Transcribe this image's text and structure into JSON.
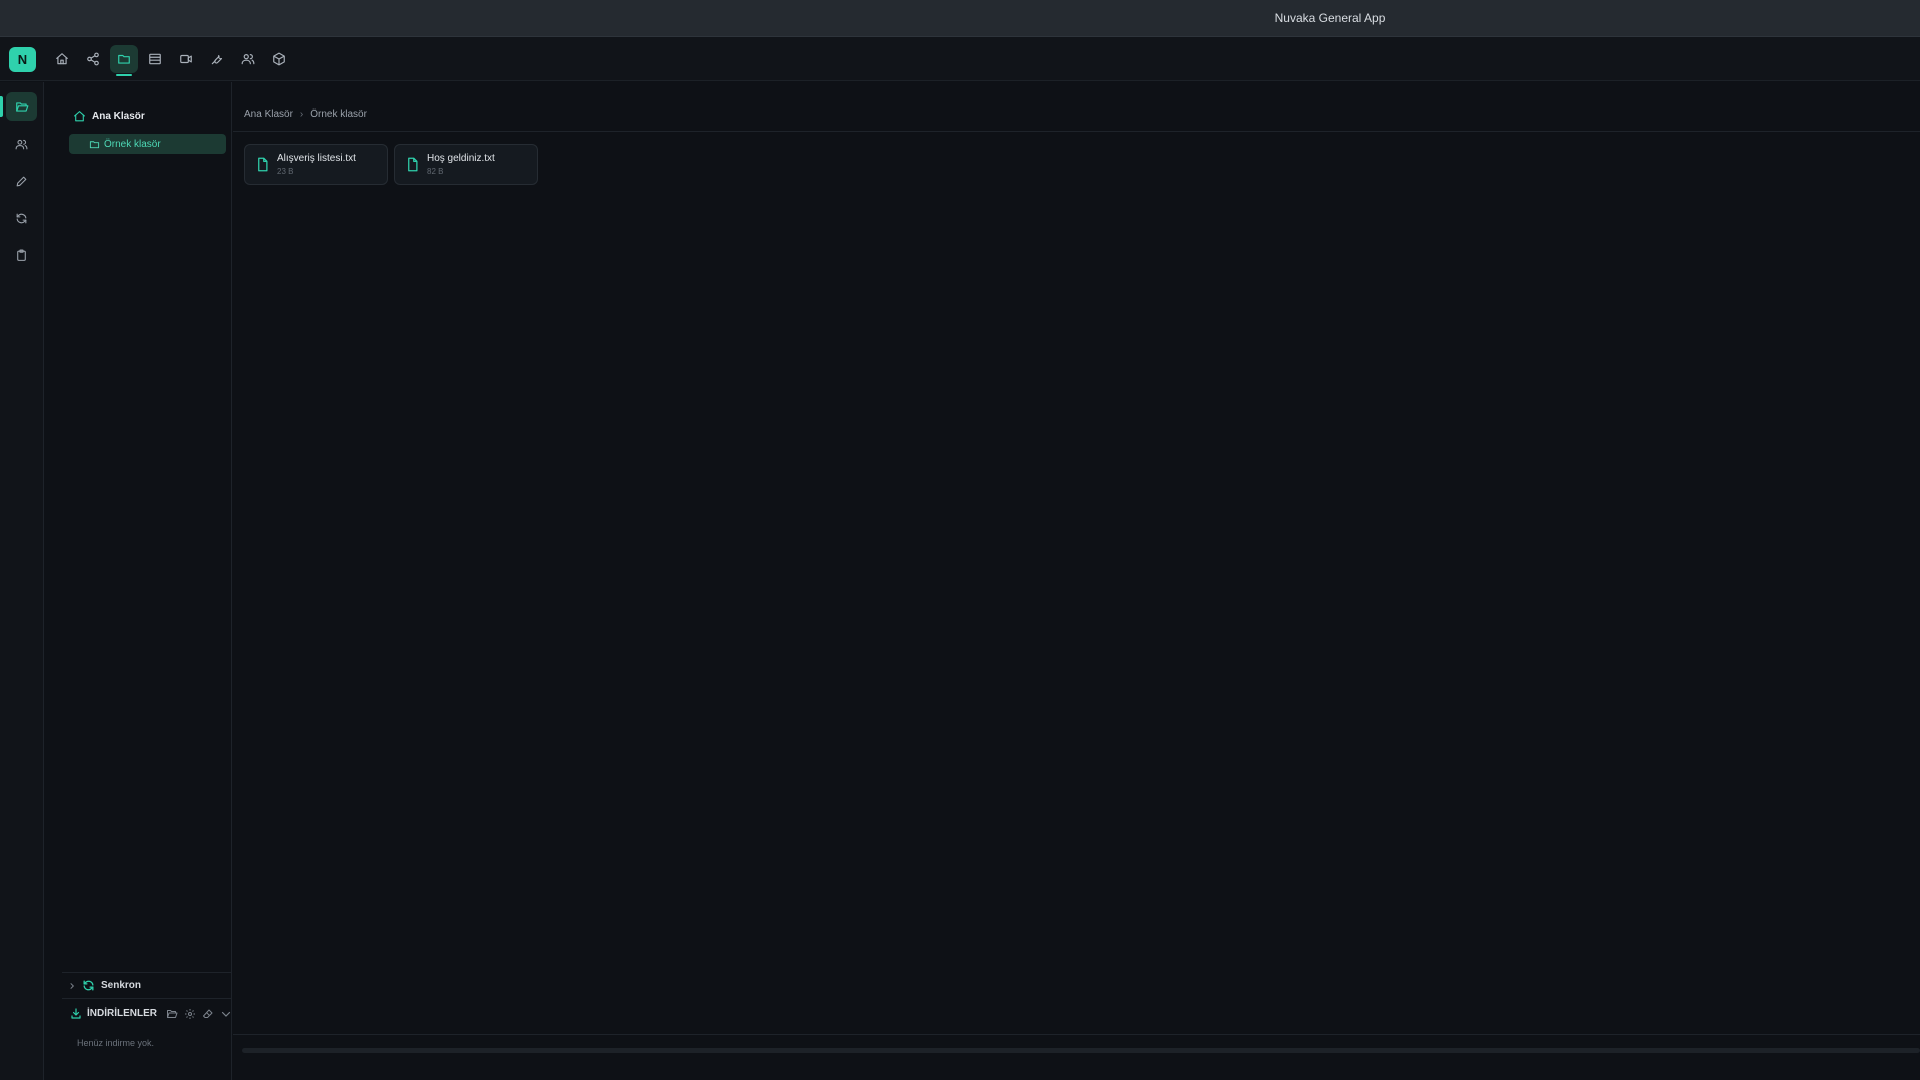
{
  "window": {
    "title": "Nuvaka General App"
  },
  "logo": {
    "letter": "N"
  },
  "topnav": {
    "items": [
      "home-icon",
      "share-icon",
      "folder-icon",
      "table-icon",
      "video-icon",
      "wrench-icon",
      "users-icon",
      "box-icon"
    ],
    "active": "folder-icon"
  },
  "rail": {
    "items": [
      "folder-open-icon",
      "users-icon",
      "pencil-icon",
      "refresh-icon",
      "clipboard-icon"
    ],
    "active": "folder-open-icon"
  },
  "tree": {
    "root_label": "Ana Klasör",
    "items": [
      {
        "label": "Örnek klasör"
      }
    ]
  },
  "sync": {
    "label": "Senkron"
  },
  "downloads": {
    "label": "İNDİRİLENLER",
    "empty_text": "Henüz indirme yok."
  },
  "breadcrumb": [
    "Ana Klasör",
    "Örnek klasör"
  ],
  "files": [
    {
      "name": "Alışveriş listesi.txt",
      "size": "23 B"
    },
    {
      "name": "Hoş geldiniz.txt",
      "size": "82 B"
    }
  ],
  "colors": {
    "accent": "#2fd1ac",
    "background": "#0e1116",
    "titlebar": "#252a30"
  }
}
